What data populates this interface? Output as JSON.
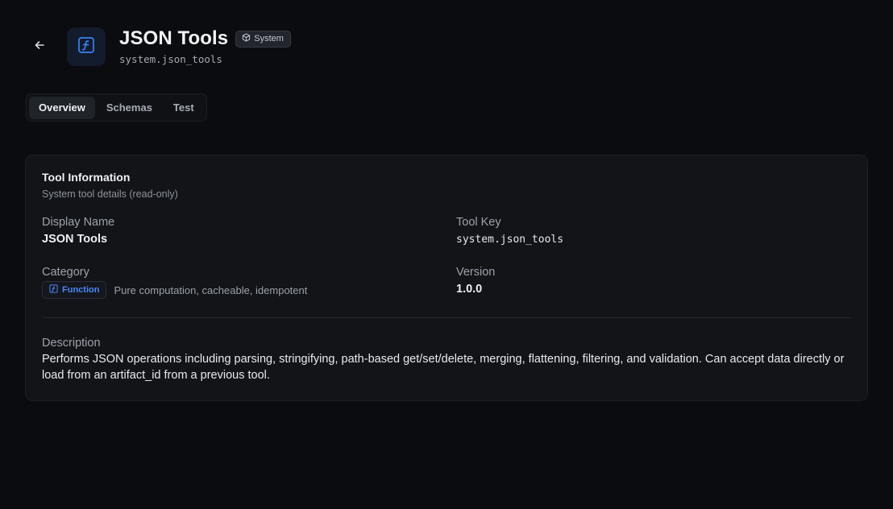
{
  "header": {
    "title": "JSON Tools",
    "badge": "System",
    "tool_key": "system.json_tools",
    "back_icon": "arrow-left-icon",
    "tool_icon": "function-icon",
    "accent_color": "#3b82f6"
  },
  "tabs": [
    {
      "label": "Overview",
      "active": true
    },
    {
      "label": "Schemas",
      "active": false
    },
    {
      "label": "Test",
      "active": false
    }
  ],
  "card": {
    "title": "Tool Information",
    "subtitle": "System tool details (read-only)",
    "display_name": {
      "label": "Display Name",
      "value": "JSON Tools"
    },
    "tool_key": {
      "label": "Tool Key",
      "value": "system.json_tools"
    },
    "category": {
      "label": "Category",
      "badge": "Function",
      "description": "Pure computation, cacheable, idempotent"
    },
    "version": {
      "label": "Version",
      "value": "1.0.0"
    },
    "description": {
      "label": "Description",
      "value": "Performs JSON operations including parsing, stringifying, path-based get/set/delete, merging, flattening, filtering, and validation. Can accept data directly or load from an artifact_id from a previous tool."
    }
  }
}
